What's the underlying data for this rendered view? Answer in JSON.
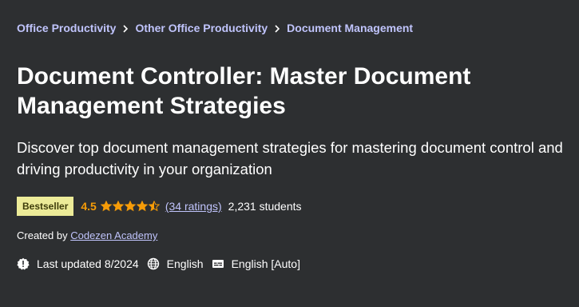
{
  "breadcrumb": {
    "items": [
      "Office Productivity",
      "Other Office Productivity",
      "Document Management"
    ]
  },
  "course": {
    "title": "Document Controller: Master Document Management Strategies",
    "subtitle": "Discover top document management strategies for mastering document control and driving productivity in your organization",
    "badge": "Bestseller",
    "rating": "4.5",
    "stars_filled": 4.5,
    "ratings_count": "(34 ratings)",
    "students": "2,231 students",
    "created_by_label": "Created by",
    "creator": "Codezen Academy",
    "last_updated": "Last updated 8/2024",
    "language": "English",
    "captions": "English [Auto]"
  },
  "icons": {
    "breadcrumb_separator": "chevron-right-icon",
    "star": "star-icon",
    "last_updated": "alert-badge-icon",
    "language": "globe-icon",
    "captions": "closed-captions-icon"
  },
  "colors": {
    "background": "#2d2f31",
    "link": "#c0c4fc",
    "rating": "#f69c08",
    "badge_bg": "#eceb98",
    "badge_text": "#3d3c0a"
  }
}
